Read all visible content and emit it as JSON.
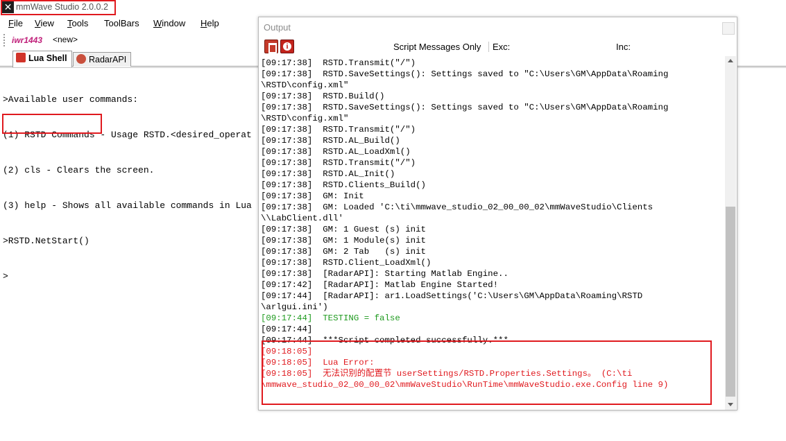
{
  "window": {
    "title": "mmWave Studio 2.0.0.2",
    "icon": "x-app-icon"
  },
  "menu": [
    {
      "accel": "F",
      "rest": "ile"
    },
    {
      "accel": "V",
      "rest": "iew"
    },
    {
      "accel": "T",
      "rest": "ools"
    },
    {
      "accel": "",
      "rest": "ToolBars"
    },
    {
      "accel": "W",
      "rest": "indow"
    },
    {
      "accel": "H",
      "rest": "elp"
    }
  ],
  "device_row": {
    "device": "iwr1443",
    "new_button": "<new>"
  },
  "tabs": [
    {
      "label": "Lua Shell",
      "active": true
    },
    {
      "label": "RadarAPI",
      "active": false
    }
  ],
  "shell": {
    "lines": [
      ">Available user commands:",
      "(1) RSTD Commands - Usage RSTD.<desired_operat",
      "(2) cls - Clears the screen.",
      "(3) help - Shows all available commands in Lua",
      ">RSTD.NetStart()",
      ">"
    ]
  },
  "output": {
    "title": "Output",
    "script_messages_only": "Script Messages Only",
    "exc_label": "Exc:",
    "inc_label": "Inc:",
    "log": [
      {
        "text": "[09:17:38]  RSTD.Transmit(\"/\")",
        "color": "black"
      },
      {
        "text": "[09:17:38]  RSTD.SaveSettings(): Settings saved to \"C:\\Users\\GM\\AppData\\Roaming",
        "color": "black"
      },
      {
        "text": "\\RSTD\\config.xml\"",
        "color": "black"
      },
      {
        "text": "[09:17:38]  RSTD.Build()",
        "color": "black"
      },
      {
        "text": "[09:17:38]  RSTD.SaveSettings(): Settings saved to \"C:\\Users\\GM\\AppData\\Roaming",
        "color": "black"
      },
      {
        "text": "\\RSTD\\config.xml\"",
        "color": "black"
      },
      {
        "text": "[09:17:38]  RSTD.Transmit(\"/\")",
        "color": "black"
      },
      {
        "text": "[09:17:38]  RSTD.AL_Build()",
        "color": "black"
      },
      {
        "text": "[09:17:38]  RSTD.AL_LoadXml()",
        "color": "black"
      },
      {
        "text": "[09:17:38]  RSTD.Transmit(\"/\")",
        "color": "black"
      },
      {
        "text": "[09:17:38]  RSTD.AL_Init()",
        "color": "black"
      },
      {
        "text": "[09:17:38]  RSTD.Clients_Build()",
        "color": "black"
      },
      {
        "text": "[09:17:38]  GM: Init",
        "color": "black"
      },
      {
        "text": "[09:17:38]  GM: Loaded 'C:\\ti\\mmwave_studio_02_00_00_02\\mmWaveStudio\\Clients",
        "color": "black"
      },
      {
        "text": "\\\\LabClient.dll'",
        "color": "black"
      },
      {
        "text": "[09:17:38]  GM: 1 Guest (s) init",
        "color": "black"
      },
      {
        "text": "[09:17:38]  GM: 1 Module(s) init",
        "color": "black"
      },
      {
        "text": "[09:17:38]  GM: 2 Tab   (s) init",
        "color": "black"
      },
      {
        "text": "[09:17:38]  RSTD.Client_LoadXml()",
        "color": "black"
      },
      {
        "text": "[09:17:38]  [RadarAPI]: Starting Matlab Engine..",
        "color": "black"
      },
      {
        "text": "[09:17:42]  [RadarAPI]: Matlab Engine Started!",
        "color": "black"
      },
      {
        "text": "[09:17:44]  [RadarAPI]: ar1.LoadSettings('C:\\Users\\GM\\AppData\\Roaming\\RSTD",
        "color": "black"
      },
      {
        "text": "\\arlgui.ini')",
        "color": "black"
      },
      {
        "text": "[09:17:44]  TESTING = false",
        "color": "green"
      },
      {
        "text": "[09:17:44]",
        "color": "black"
      },
      {
        "text": "[09:17:44]  ***Script completed successfully.***",
        "color": "black"
      },
      {
        "text": "[09:18:05]",
        "color": "red"
      },
      {
        "text": "[09:18:05]  Lua Error:",
        "color": "red"
      },
      {
        "text": "[09:18:05]  无法识别的配置节 userSettings/RSTD.Properties.Settings。 (C:\\ti",
        "color": "red"
      },
      {
        "text": "\\mmwave_studio_02_00_00_02\\mmWaveStudio\\RunTime\\mmWaveStudio.exe.Config line 9)",
        "color": "red"
      }
    ]
  },
  "colors": {
    "highlight": "#e0191e",
    "log_green": "#1e9a1e",
    "log_red": "#e0191e",
    "device_name": "#c0207a"
  }
}
